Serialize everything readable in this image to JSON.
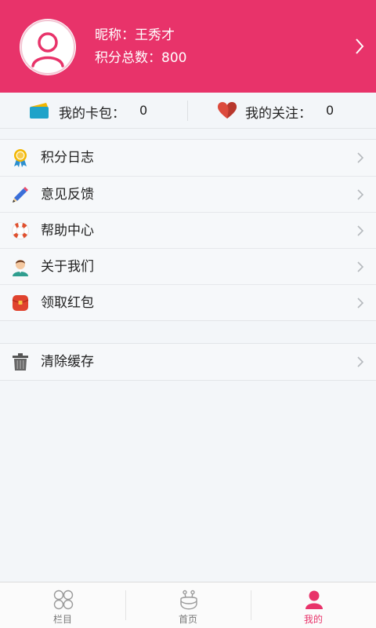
{
  "profile": {
    "nickname": "昵称：王秀才",
    "points": "积分总数：800"
  },
  "stats": {
    "card_label": "我的卡包：",
    "card_value": "0",
    "follow_label": "我的关注：",
    "follow_value": "0"
  },
  "menu": {
    "items": [
      {
        "label": "积分日志",
        "icon": "medal-icon"
      },
      {
        "label": "意见反馈",
        "icon": "pencil-icon"
      },
      {
        "label": "帮助中心",
        "icon": "lifebuoy-icon"
      },
      {
        "label": "关于我们",
        "icon": "person-icon"
      },
      {
        "label": "领取红包",
        "icon": "red-envelope-icon"
      }
    ],
    "extra": [
      {
        "label": "清除缓存",
        "icon": "trash-icon"
      }
    ]
  },
  "tabs": [
    {
      "label": "栏目",
      "icon": "grid-circles-icon"
    },
    {
      "label": "首页",
      "icon": "robot-icon"
    },
    {
      "label": "我的",
      "icon": "user-icon",
      "active": true
    }
  ],
  "colors": {
    "brand": "#e8336a",
    "background": "#f3f6f9"
  }
}
